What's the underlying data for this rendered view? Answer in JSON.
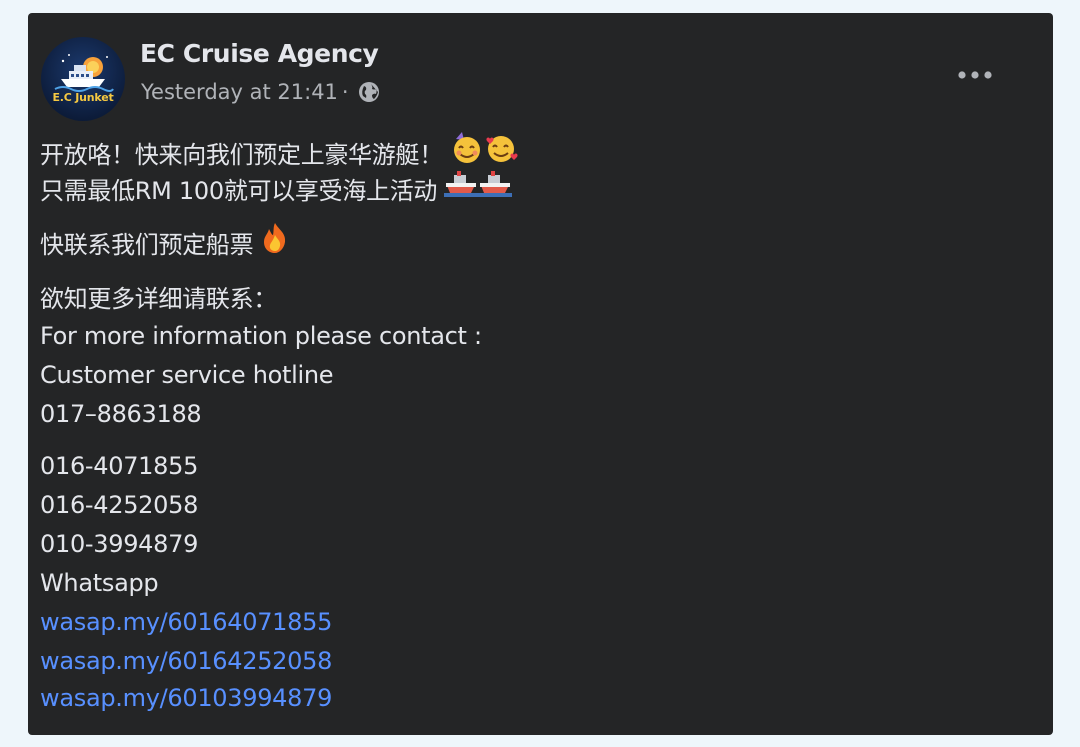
{
  "post": {
    "page_name": "EC Cruise Agency",
    "avatar_text": "E.C Junket",
    "timestamp": "Yesterday at 21:41",
    "separator": "·",
    "privacy_icon": "globe-icon",
    "more_icon": "more-options-icon",
    "body": {
      "line1": "开放咯！快来向我们预定上豪华游艇！",
      "line1_emoji": [
        "smiling-face-with-hearts",
        "smiling-face-with-hearts"
      ],
      "line2": "只需最低RM 100就可以享受海上活动",
      "line2_emoji": [
        "ship",
        "ship"
      ],
      "line3": "快联系我们预定船票",
      "line3_emoji": [
        "fire"
      ],
      "line4": "欲知更多详细请联系：",
      "line5": "For more information please contact :",
      "line6": "Customer service hotline",
      "line7": "017–8863188",
      "phones": [
        "016-4071855",
        "016-4252058",
        "010-3994879"
      ],
      "whatsapp_label": "Whatsapp",
      "links": [
        "wasap.my/60164071855",
        "wasap.my/60164252058",
        "wasap.my/60103994879"
      ]
    }
  },
  "colors": {
    "page_background": "#eef6fb",
    "card_background": "#242526",
    "primary_text": "#e4e6eb",
    "secondary_text": "#b0b3b8",
    "link": "#5890ff"
  }
}
